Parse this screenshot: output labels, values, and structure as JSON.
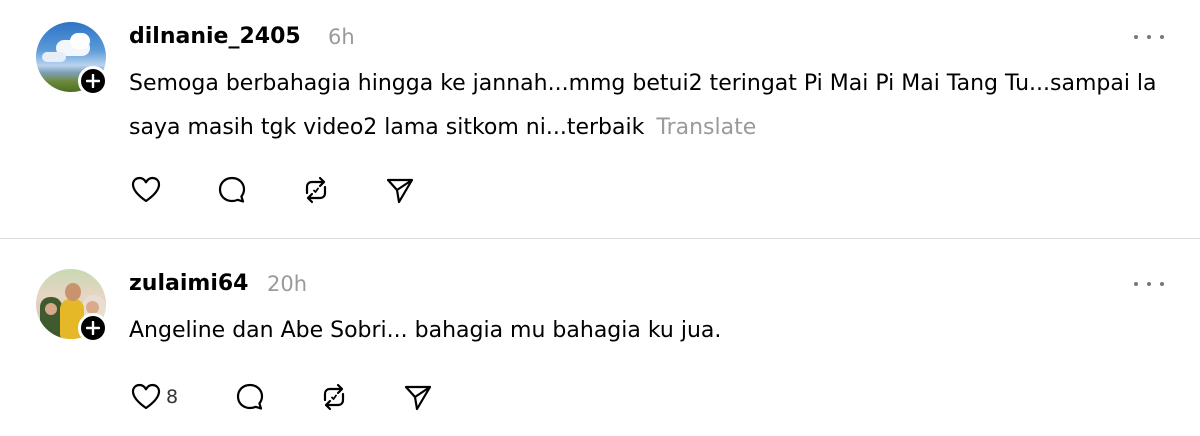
{
  "colors": {
    "text": "#000000",
    "muted": "#9a9a9a",
    "divider": "#dcdcdc",
    "icon": "#000000"
  },
  "posts": [
    {
      "username": "dilnanie_2405",
      "time": "6h",
      "avatar_icon": "avatar-sky-clouds",
      "text": "Semoga berbahagia hingga ke jannah...mmg betui2 teringat Pi Mai Pi Mai Tang Tu...sampai la saya masih tgk video2 lama sitkom ni...terbaik",
      "translate_label": "Translate",
      "likes": ""
    },
    {
      "username": "zulaimi64",
      "time": "20h",
      "avatar_icon": "avatar-family-photo",
      "text": "Angeline dan Abe Sobri... bahagia mu bahagia ku jua.",
      "translate_label": "",
      "likes": "8"
    }
  ],
  "icons": {
    "like": "heart-icon",
    "reply": "comment-icon",
    "repost": "repost-icon",
    "share": "send-icon",
    "more": "more-icon",
    "follow": "plus-icon"
  }
}
